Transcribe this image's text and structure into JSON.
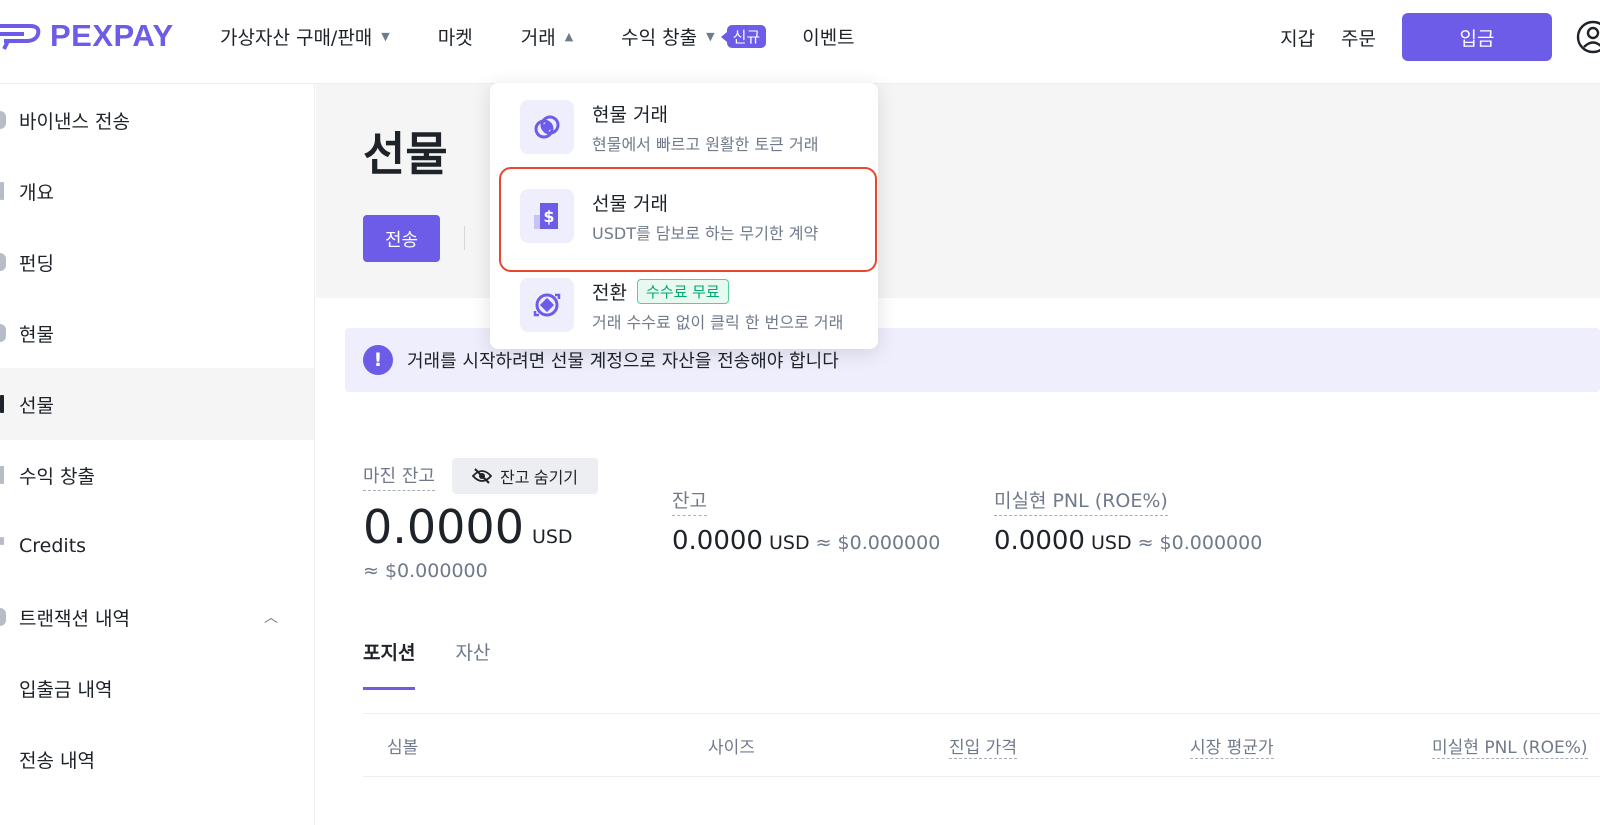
{
  "header": {
    "logo_text": "PEXPAY",
    "nav": [
      {
        "label": "가상자산 구매/판매"
      },
      {
        "label": "마켓"
      },
      {
        "label": "거래"
      },
      {
        "label": "수익 창출",
        "badge": "신규"
      },
      {
        "label": "이벤트"
      }
    ],
    "wallet": "지갑",
    "orders": "주문",
    "deposit": "입금"
  },
  "sidebar": {
    "items": [
      {
        "label": "바이낸스 전송"
      },
      {
        "label": "개요"
      },
      {
        "label": "펀딩"
      },
      {
        "label": "현물"
      },
      {
        "label": "선물"
      },
      {
        "label": "수익 창출"
      },
      {
        "label": "Credits"
      },
      {
        "label": "트랜잭션 내역"
      },
      {
        "label": "입출금 내역"
      },
      {
        "label": "전송 내역"
      }
    ]
  },
  "main": {
    "title": "선물",
    "transfer_button": "전송",
    "notice": "거래를 시작하려면 선물 계정으로 자산을 전송해야 합니다",
    "margin_label": "마진 잔고",
    "hide_balance": "잔고 숨기기",
    "margin_value": "0.0000",
    "margin_unit": "USD",
    "margin_approx": "≈ $0.000000",
    "balance": {
      "label": "잔고",
      "value": "0.0000",
      "unit": "USD",
      "approx": "≈ $0.000000"
    },
    "pnl": {
      "label": "미실현 PNL (ROE%)",
      "value": "0.0000",
      "unit": "USD",
      "approx": "≈ $0.000000"
    },
    "tabs": [
      "포지션",
      "자산"
    ],
    "table_headers": [
      "심볼",
      "사이즈",
      "진입 가격",
      "시장 평균가",
      "미실현 PNL (ROE%)"
    ]
  },
  "dropdown": {
    "items": [
      {
        "title": "현물 거래",
        "sub": "현물에서 빠르고 원활한 토큰 거래"
      },
      {
        "title": "선물 거래",
        "sub": "USDT를 담보로 하는 무기한 계약"
      },
      {
        "title": "전환",
        "badge": "수수료 무료",
        "sub": "거래 수수료 없이 클릭 한 번으로 거래"
      }
    ]
  },
  "colors": {
    "accent": "#6c5ce7",
    "highlight": "#e8472e",
    "free_badge": "#02a86a"
  }
}
